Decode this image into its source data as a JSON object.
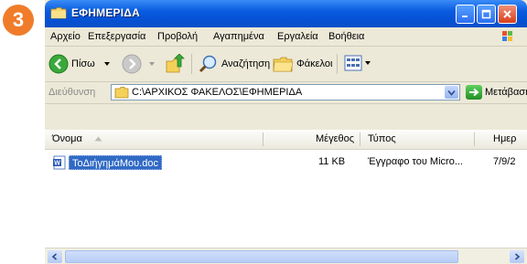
{
  "step": "3",
  "window": {
    "title": "ΕΦΗΜΕΡΙΔΑ"
  },
  "menu": [
    "Αρχείο",
    "Επεξεργασία",
    "Προβολή",
    "Αγαπημένα",
    "Εργαλεία",
    "Βοήθεια"
  ],
  "toolbar": {
    "back_label": "Πίσω",
    "search_label": "Αναζήτηση",
    "folders_label": "Φάκελοι"
  },
  "address": {
    "label": "Διεύθυνση",
    "value": "C:\\ΑΡΧΙΚΟΣ ΦΑΚΕΛΟΣ\\ΕΦΗΜΕΡΙΔΑ",
    "go_label": "Μετάβαση"
  },
  "columns": {
    "name": "Όνομα",
    "size": "Μέγεθος",
    "type": "Τύπος",
    "date": "Ημερ"
  },
  "files": [
    {
      "name": "ΤοΔιήγημάΜου.doc",
      "size": "11 KB",
      "type": "Έγγραφο του Micro...",
      "date": "7/9/2"
    }
  ],
  "colors": {
    "titlebar": "#0a5ce0",
    "selection": "#316ac5",
    "badge": "#f07c2a"
  }
}
